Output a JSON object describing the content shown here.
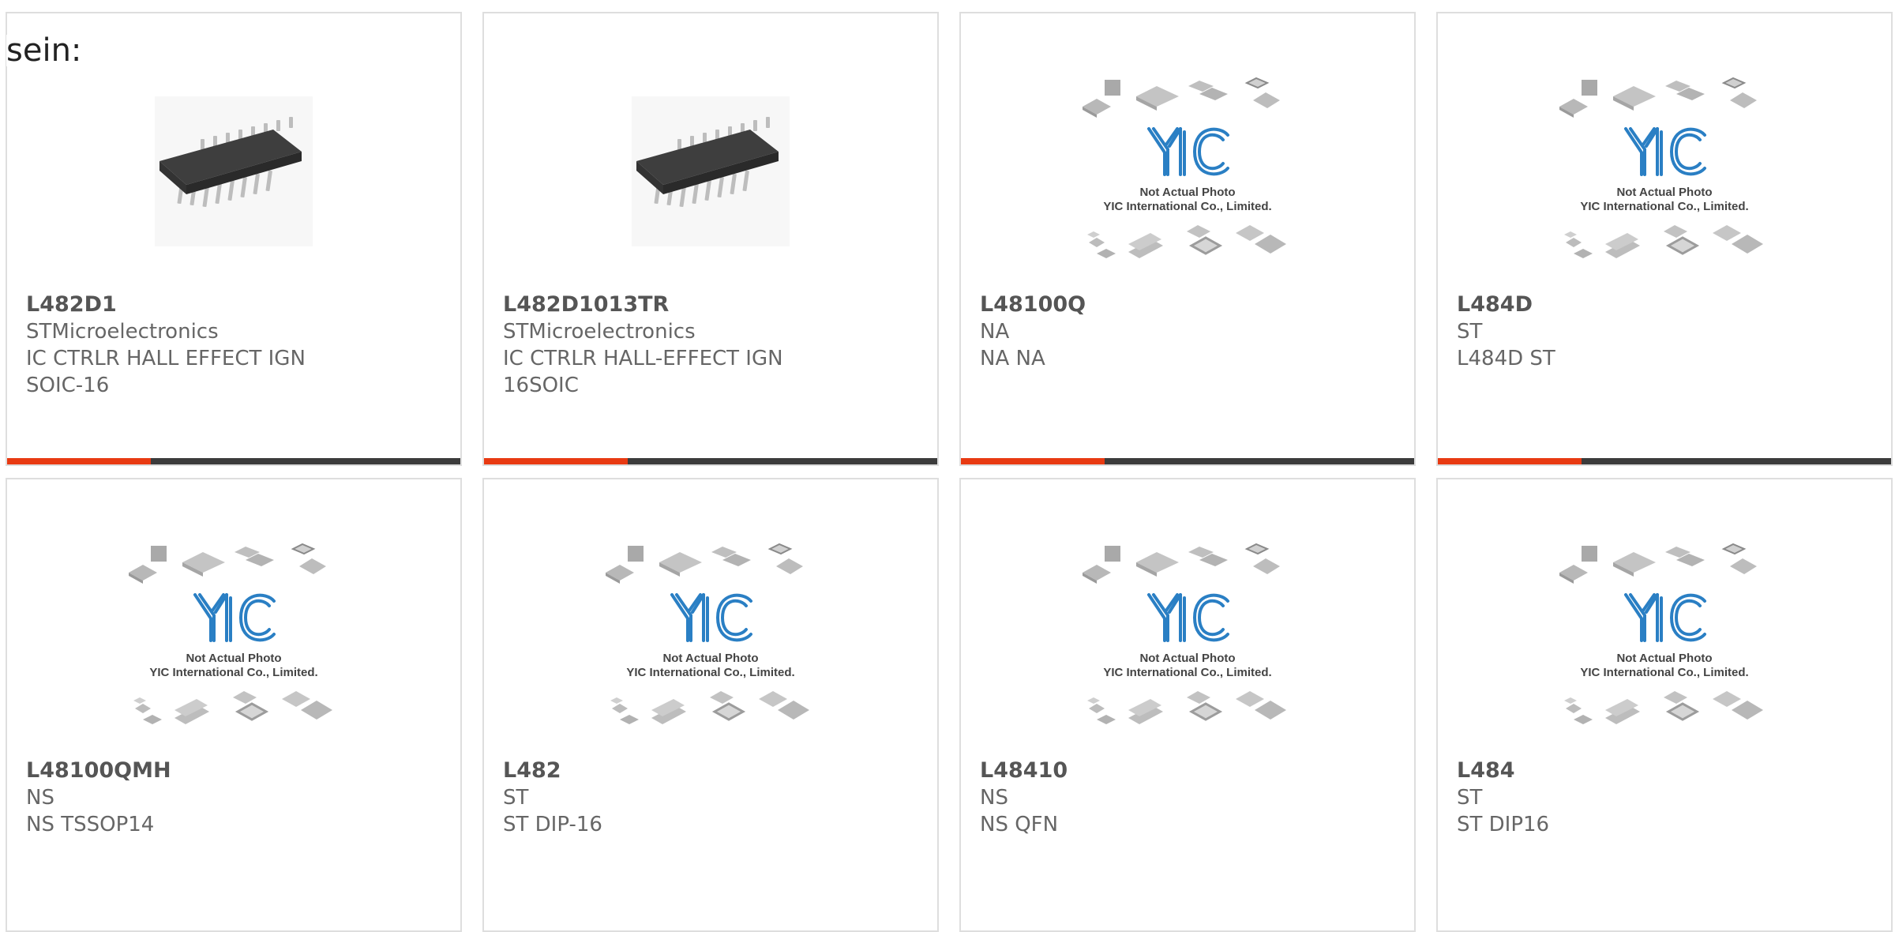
{
  "page": {
    "heading": "sein:"
  },
  "placeholder": {
    "line1": "Not Actual Photo",
    "line2": "YIC International Co., Limited.",
    "logo_text": "YIC"
  },
  "colors": {
    "accent": "#e83a12",
    "bar": "#3c3c3c",
    "border": "#dedede",
    "logo": "#2a7fc4"
  },
  "cards": [
    {
      "part": "L482D1",
      "mfr": "STMicroelectronics",
      "desc": "IC CTRLR HALL EFFECT IGN",
      "pkg": "SOIC-16",
      "image": "soic-chip-photo"
    },
    {
      "part": "L482D1013TR",
      "mfr": "STMicroelectronics",
      "desc": "IC CTRLR HALL-EFFECT IGN",
      "pkg": "16SOIC",
      "image": "soic-chip-photo"
    },
    {
      "part": "L48100Q",
      "mfr": "NA",
      "desc": "NA NA",
      "pkg": "",
      "image": "not-actual-photo-placeholder"
    },
    {
      "part": "L484D",
      "mfr": "ST",
      "desc": "L484D ST",
      "pkg": "",
      "image": "not-actual-photo-placeholder"
    },
    {
      "part": "L48100QMH",
      "mfr": "NS",
      "desc": "NS TSSOP14",
      "pkg": "",
      "image": "not-actual-photo-placeholder"
    },
    {
      "part": "L482",
      "mfr": "ST",
      "desc": "ST DIP-16",
      "pkg": "",
      "image": "not-actual-photo-placeholder"
    },
    {
      "part": "L48410",
      "mfr": "NS",
      "desc": "NS QFN",
      "pkg": "",
      "image": "not-actual-photo-placeholder"
    },
    {
      "part": "L484",
      "mfr": "ST",
      "desc": "ST DIP16",
      "pkg": "",
      "image": "not-actual-photo-placeholder"
    }
  ]
}
